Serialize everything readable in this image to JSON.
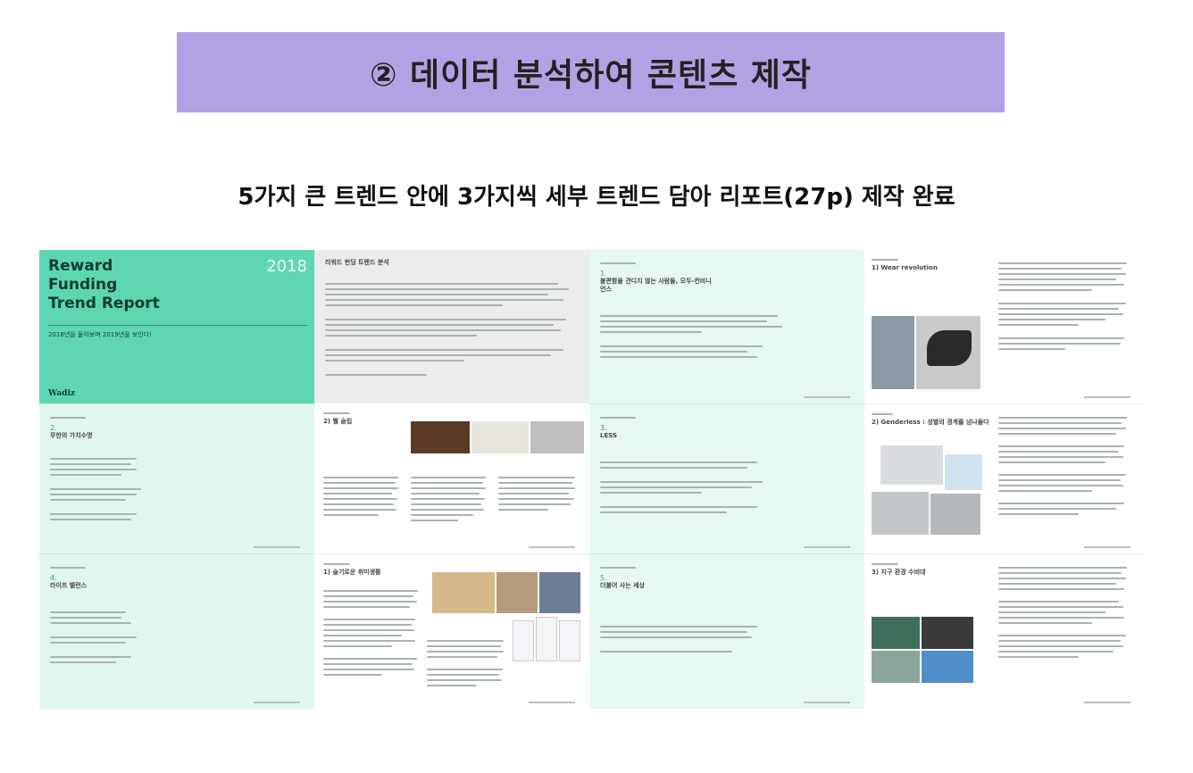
{
  "banner": {
    "text": "② 데이터 분석하여 콘텐츠 제작"
  },
  "subtitle": {
    "text": "5가지 큰 트렌드 안에 3가지씩 세부 트렌드 담아 리포트(27p) 제작 완료"
  },
  "cover": {
    "title_line1": "Reward",
    "title_line2": "Funding",
    "title_line3": "Trend Report",
    "year": "2018",
    "tagline": "2018년을 돌아보며 2019년을 보인다!",
    "brand": "Wadiz"
  },
  "pages": {
    "intro_heading": "리워드 펀딩 트렌드 분석",
    "sec1_num": "1.",
    "sec1_title": "불편함을 견디지 않는 사람들, 모두-컨비니언스",
    "sec2_num": "2.",
    "sec2_title": "무한의 가치수명",
    "sec2_item": "2) 웰 슬립",
    "sec3_num": "3.",
    "sec3_title": "LESS",
    "sec4_num": "4.",
    "sec4_title": "라이프 밸런스",
    "sec4_item": "1) 슬기로운 취미생활",
    "sec5_num": "5.",
    "sec5_title": "더불어 사는 세상",
    "wear_title": "1) Wear revolution",
    "gender_title": "2) Genderless : 성별의 경계를 넘나들다",
    "earth_title": "3) 지구 환경 수비대"
  },
  "colors": {
    "banner": "#b3a2e3",
    "cover": "#5ed6b4",
    "mint": "#dff7ef"
  }
}
